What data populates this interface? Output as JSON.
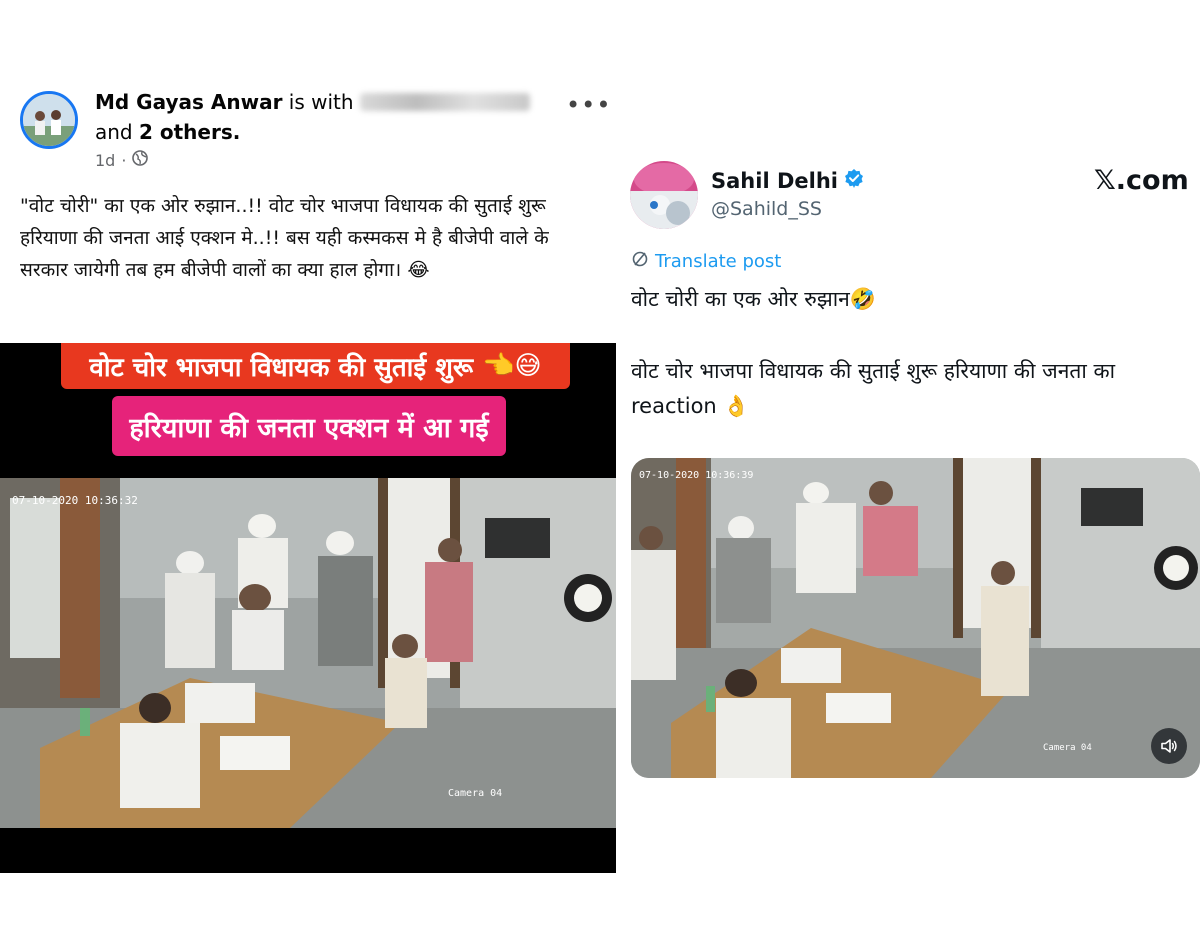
{
  "facebook_post": {
    "author": "Md Gayas Anwar",
    "with_text": "is with",
    "and_text": "and",
    "others": "2 others.",
    "time": "1d",
    "separator": "·",
    "privacy_icon": "globe-icon",
    "menu_icon": "ellipsis-icon",
    "text": "\"वोट चोरी\" का एक ओर रुझान..!!  वोट चोर भाजपा विधायक की सुताई शुरू हरियाणा की जनता आई एक्शन मे..!! बस यही कस्मकस मे है बीजेपी वाले के सरकार जायेगी तब हम बीजेपी वालों का क्या हाल होगा।",
    "emoji": "😂",
    "video": {
      "banner_top": "वोट चोर भाजपा विधायक की सुताई शुरू",
      "banner_top_emoji": "👈😅",
      "banner_bottom": "हरियाणा की जनता एक्शन में आ गई",
      "cctv_timestamp": "07-10-2020  10:36:32",
      "camera_label": "Camera 04"
    }
  },
  "x_post": {
    "name": "Sahil Delhi",
    "verified_icon": "verified-badge-icon",
    "handle": "@Sahild_SS",
    "site_logo": "𝕏.com",
    "translate": "Translate post",
    "line1": "वोट चोरी का एक ओर रुझान🤣",
    "line2": "वोट चोर भाजपा विधायक की सुताई शुरू हरियाणा की जनता का reaction 👌",
    "video": {
      "cctv_timestamp": "07-10-2020  10:36:39",
      "camera_label": "Camera 04",
      "mute_icon": "speaker-icon"
    }
  },
  "colors": {
    "facebook_blue": "#1877f2",
    "x_blue": "#1d9bf0",
    "banner_red": "#e8381f",
    "banner_pink": "#e6237a"
  }
}
